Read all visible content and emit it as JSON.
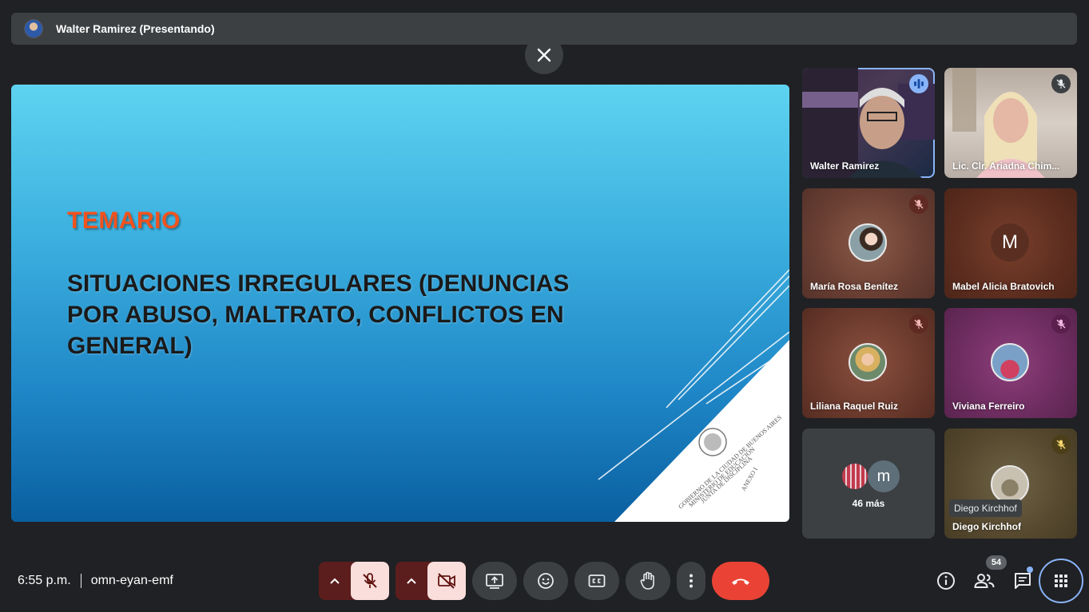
{
  "presenter_bar": {
    "title": "Walter Ramirez (Presentando)"
  },
  "slide": {
    "heading": "TEMARIO",
    "body": "SITUACIONES IRREGULARES (DENUNCIAS POR ABUSO, MALTRATO, CONFLICTOS EN GENERAL)",
    "stamp_lines": [
      "GOBIERNO DE LA CIUDAD DE BUENOS AIRES",
      "MINISTERIO DE EDUCACIÓN",
      "JUNTA DE DISCIPLINA",
      "ANEXO I"
    ]
  },
  "participants": [
    {
      "name": "Walter Ramirez",
      "speaking": true
    },
    {
      "name": "Lic. Clr. Ariadna Chim...",
      "muted": true
    },
    {
      "name": "María Rosa Benítez",
      "muted": true
    },
    {
      "name": "Mabel Alicia Bratovich",
      "initial": "M"
    },
    {
      "name": "Liliana Raquel Ruiz",
      "muted": true
    },
    {
      "name": "Viviana Ferreiro",
      "muted": true
    },
    {
      "name": "46 más",
      "initial": "m"
    },
    {
      "name": "Diego Kirchhof",
      "muted": true,
      "tooltip": "Diego Kirchhof"
    }
  ],
  "meeting": {
    "time": "6:55 p.m.",
    "code": "omn-eyan-emf"
  },
  "people_count": "54",
  "colors": {
    "accent": "#8ab4f8",
    "end_call": "#ea4335",
    "muted_red": "#5c1d1d",
    "heading_orange": "#f2521e"
  }
}
